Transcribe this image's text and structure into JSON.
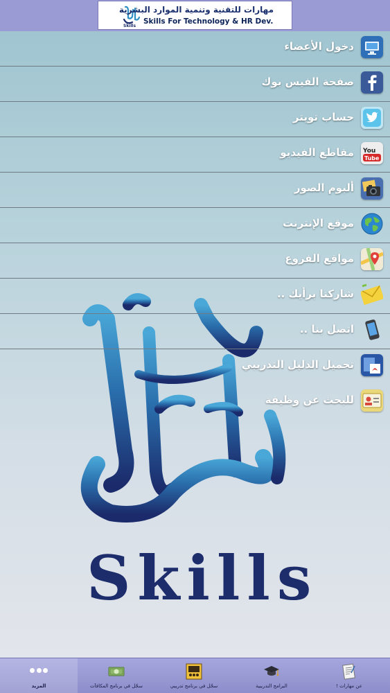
{
  "header": {
    "title_ar": "مهارات للتقنية وتنمية الموارد البشرية",
    "title_en": "Skills For Technology & HR Dev.",
    "logo_word": "Skills"
  },
  "colors": {
    "header_bg": "#9a9ad4",
    "tabbar_bg": "#9898d6",
    "menu_text": "#ffffff",
    "brand_blue": "#1d2c6b",
    "brand_cyan": "#2f8fc4"
  },
  "menu": {
    "items": [
      {
        "label": "دخول الأعضاء",
        "icon": "monitor-icon"
      },
      {
        "label": "صفحة الفيس بوك",
        "icon": "facebook-icon"
      },
      {
        "label": "حساب تويتر",
        "icon": "twitter-icon"
      },
      {
        "label": "مقاطع الفيديو",
        "icon": "youtube-icon"
      },
      {
        "label": "ألبوم الصور",
        "icon": "camera-icon"
      },
      {
        "label": "موقع الإنترنت",
        "icon": "globe-icon"
      },
      {
        "label": "مواقع الفروع",
        "icon": "map-icon"
      },
      {
        "label": "شاركنا برأيك ..",
        "icon": "mail-icon"
      },
      {
        "label": "اتصل بنا ..",
        "icon": "phone-icon"
      },
      {
        "label": "تحميل الدليل التدريبي",
        "icon": "pdf-icon"
      },
      {
        "label": "للبحث عن وظيفة",
        "icon": "id-card-icon"
      }
    ]
  },
  "tabbar": {
    "tabs": [
      {
        "label": "المزيد",
        "icon": "more-dots-icon"
      },
      {
        "label": "سجّل في برنامج المكافآت",
        "icon": "money-icon"
      },
      {
        "label": "سجّل في برنامج تدريبي",
        "icon": "presentation-icon"
      },
      {
        "label": "البرامج التدريبية",
        "icon": "graduation-cap-icon"
      },
      {
        "label": "عن مهارات !",
        "icon": "document-icon"
      }
    ]
  }
}
